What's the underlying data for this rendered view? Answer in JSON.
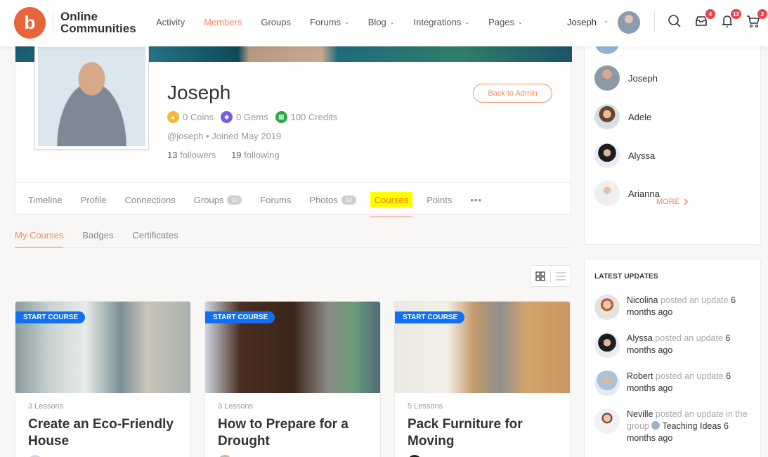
{
  "header": {
    "logo_glyph": "b",
    "site_name_line1": "Online",
    "site_name_line2": "Communities",
    "nav": [
      {
        "label": "Activity",
        "active": false,
        "dropdown": false
      },
      {
        "label": "Members",
        "active": true,
        "dropdown": false
      },
      {
        "label": "Groups",
        "active": false,
        "dropdown": false
      },
      {
        "label": "Forums",
        "active": false,
        "dropdown": true
      },
      {
        "label": "Blog",
        "active": false,
        "dropdown": true
      },
      {
        "label": "Integrations",
        "active": false,
        "dropdown": true
      },
      {
        "label": "Pages",
        "active": false,
        "dropdown": true
      }
    ],
    "user_name": "Joseph",
    "chevron": "⌄",
    "badges": {
      "messages": "4",
      "notifications": "12",
      "cart": "2"
    }
  },
  "profile": {
    "name": "Joseph",
    "coins": "0 Coins",
    "gems": "0 Gems",
    "credits": "100 Credits",
    "handle": "@joseph • Joined May 2019",
    "followers_count": "13",
    "followers_label": "followers",
    "following_count": "19",
    "following_label": "following",
    "back_button": "Back to Admin",
    "colors": {
      "coins": "#f2b838",
      "gems": "#7b5cf0",
      "credits": "#2aa843",
      "accent": "#f28b5e"
    },
    "tabs": [
      {
        "label": "Timeline",
        "count": null
      },
      {
        "label": "Profile",
        "count": null
      },
      {
        "label": "Connections",
        "count": null
      },
      {
        "label": "Groups",
        "count": "10"
      },
      {
        "label": "Forums",
        "count": null
      },
      {
        "label": "Photos",
        "count": "13"
      },
      {
        "label": "Courses",
        "count": null,
        "active": true
      },
      {
        "label": "Points",
        "count": null
      }
    ],
    "more_tabs": "•••"
  },
  "subtabs": [
    {
      "label": "My Courses",
      "active": true
    },
    {
      "label": "Badges",
      "active": false
    },
    {
      "label": "Certificates",
      "active": false
    }
  ],
  "courses": [
    {
      "badge": "START COURSE",
      "lessons": "3 Lessons",
      "title": "Create an Eco-Friendly House"
    },
    {
      "badge": "START COURSE",
      "lessons": "3 Lessons",
      "title": "How to Prepare for a Drought"
    },
    {
      "badge": "START COURSE",
      "lessons": "5 Lessons",
      "title": "Pack Furniture for Moving"
    }
  ],
  "members_widget": {
    "members": [
      "Joseph",
      "Adele",
      "Alyssa",
      "Arianna"
    ],
    "more_label": "MORE"
  },
  "latest_updates": {
    "title": "LATEST UPDATES",
    "items": [
      {
        "name": "Nicolina",
        "action": "posted an update",
        "group": "",
        "time": "6 months ago"
      },
      {
        "name": "Alyssa",
        "action": "posted an update",
        "group": "",
        "time": "6 months ago"
      },
      {
        "name": "Robert",
        "action": "posted an update",
        "group": "",
        "time": "6 months ago"
      },
      {
        "name": "Neville",
        "action": "posted an update in the group",
        "group": "Teaching Ideas",
        "time": "6 months ago"
      }
    ]
  }
}
